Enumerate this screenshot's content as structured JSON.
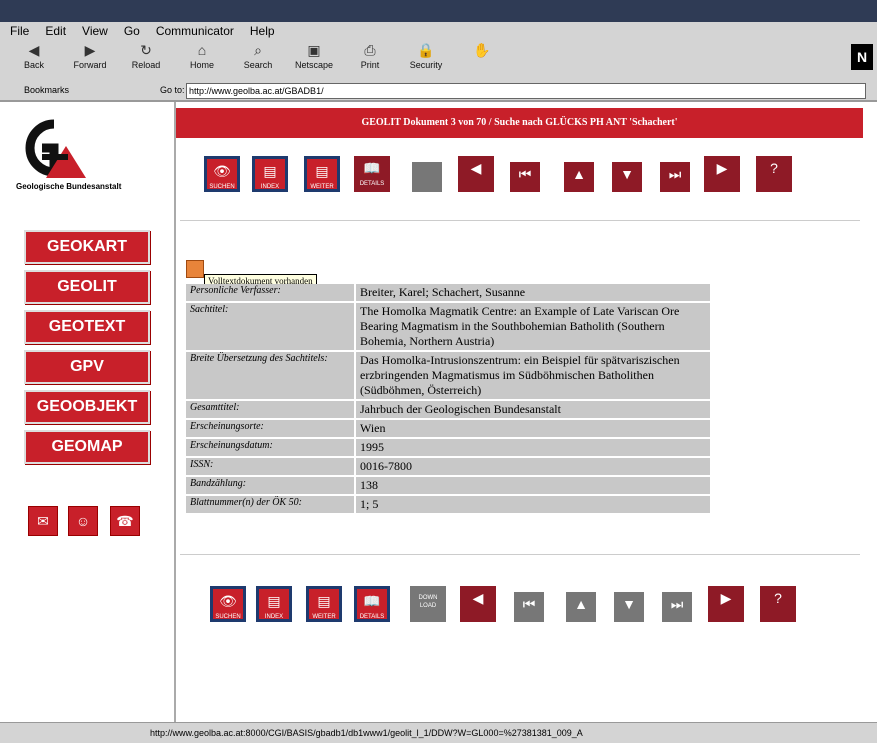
{
  "menu": [
    "File",
    "Edit",
    "View",
    "Go",
    "Communicator",
    "Help"
  ],
  "toolbar": [
    {
      "label": "Back",
      "icon": "back-icon"
    },
    {
      "label": "Forward",
      "icon": "forward-icon"
    },
    {
      "label": "Reload",
      "icon": "reload-icon"
    },
    {
      "label": "Home",
      "icon": "home-icon"
    },
    {
      "label": "Search",
      "icon": "search-icon"
    },
    {
      "label": "Netscape",
      "icon": "netscape-icon"
    },
    {
      "label": "Print",
      "icon": "print-icon"
    },
    {
      "label": "Security",
      "icon": "security-icon"
    },
    {
      "label": "",
      "icon": "stop-icon"
    }
  ],
  "location": {
    "bookmarks": "Bookmarks",
    "goto": "Go to:",
    "url": "http://www.geolba.ac.at/GBADB1/"
  },
  "logo": {
    "caption": "Geologische Bundesanstalt"
  },
  "nav": [
    "GEOKART",
    "GEOLIT",
    "GEOTEXT",
    "GPV",
    "GEOOBJEKT",
    "GEOMAP"
  ],
  "banner": "GEOLIT Dokument 3 von 70 / Suche nach GLÜCKS PH ANT 'Schachert'",
  "tooltip": "Volltextdokument vorhanden",
  "buttons": {
    "suchen": "SUCHEN",
    "index": "INDEX",
    "weiter": "WEITER",
    "details": "DETAILS",
    "download": "DOWN LOAD"
  },
  "rows": [
    {
      "label": "Personliche Verfasser:",
      "value": "Breiter, Karel; Schachert, Susanne"
    },
    {
      "label": "Sachtitel:",
      "value": "The Homolka Magmatik Centre: an Example of Late Variscan Ore Bearing Magmatism in the Southbohemian Batholith (Southern Bohemia, Northern Austria)"
    },
    {
      "label": "Breite Übersetzung des Sachtitels:",
      "value": "Das Homolka-Intrusionszentrum: ein Beispiel für spätvariszischen erzbringenden Magmatismus im Südböhmischen Batholithen (Südböhmen, Österreich)"
    },
    {
      "label": "Gesamttitel:",
      "value": "Jahrbuch der Geologischen Bundesanstalt"
    },
    {
      "label": "Erscheinungsorte:",
      "value": "Wien"
    },
    {
      "label": "Erscheinungsdatum:",
      "value": "1995"
    },
    {
      "label": "ISSN:",
      "value": "0016-7800"
    },
    {
      "label": "Bandzählung:",
      "value": "138"
    },
    {
      "label": "Blattnummer(n) der ÖK 50:",
      "value": "1; 5"
    }
  ],
  "status": "http://www.geolba.ac.at:8000/CGI/BASIS/gbadb1/db1www1/geolit_l_1/DDW?W=GL000=%27381381_009_A"
}
